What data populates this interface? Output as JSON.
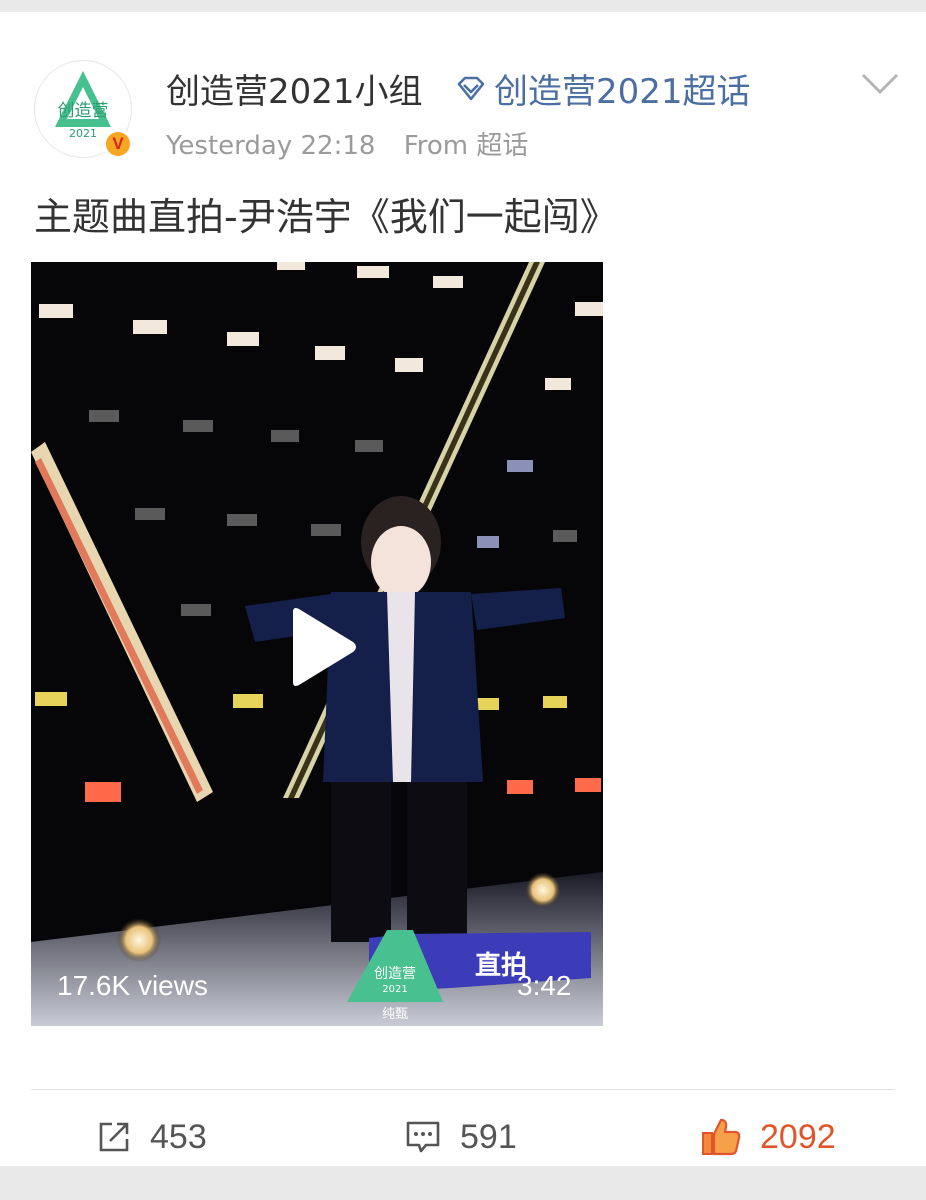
{
  "post": {
    "username": "创造营2021小组",
    "topic": "创造营2021超话",
    "time": "Yesterday 22:18",
    "source": "From 超话",
    "text": "主题曲直拍-尹浩宇《我们一起闯》",
    "avatar_badge": "V",
    "avatar_logo_text": "创造营",
    "avatar_logo_year": "2021"
  },
  "video": {
    "views": "17.6K views",
    "duration": "3:42",
    "watermark_logo": "创造营",
    "watermark_year": "2021",
    "watermark_sub": "纯甄",
    "watermark_label": "直拍"
  },
  "actions": {
    "reposts": "453",
    "comments": "591",
    "likes": "2092"
  },
  "colors": {
    "link_blue": "#4b6fa3",
    "like_orange": "#e0562c",
    "logo_green": "#3fbf8a",
    "verified_badge": "#f5a623"
  },
  "icons": [
    "creation-camp-logo-icon",
    "verified-v-icon",
    "super-topic-diamond-icon",
    "chevron-down-icon",
    "play-icon",
    "share-icon",
    "comment-icon",
    "thumbs-up-icon"
  ]
}
